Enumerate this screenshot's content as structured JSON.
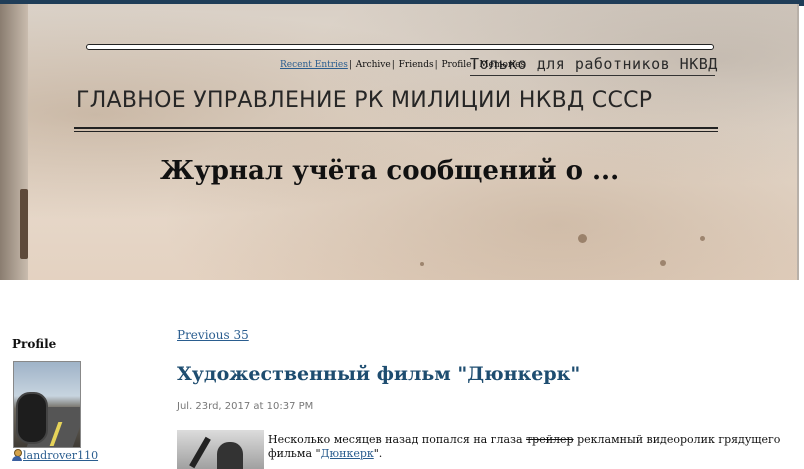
{
  "header": {
    "stamp_text": "Только для работников НКВД",
    "department_text": "ГЛАВНОЕ УПРАВЛЕНИЕ РК МИЛИЦИИ НКВД СССР",
    "journal_title": "Журнал учёта сообщений о ..."
  },
  "nav": {
    "recent_entries": "Recent Entries",
    "archive": "Archive",
    "friends": "Friends",
    "profile": "Profile",
    "memories": "Memories",
    "separator": "|"
  },
  "sidebar": {
    "profile_title": "Profile",
    "username": "landrover110"
  },
  "main": {
    "previous_link": "Previous 35",
    "post": {
      "title": "Художественный фильм \"Дюнкерк\"",
      "date": "Jul. 23rd, 2017 at 10:37 PM",
      "body_before": "Несколько месяцев назад попался на глаза ",
      "body_struck": "трейлер",
      "body_after": " рекламный видеоролик грядущего фильма ",
      "body_quote_open": "\"",
      "body_link": "Дюнкерк",
      "body_quote_close": "\"."
    }
  }
}
